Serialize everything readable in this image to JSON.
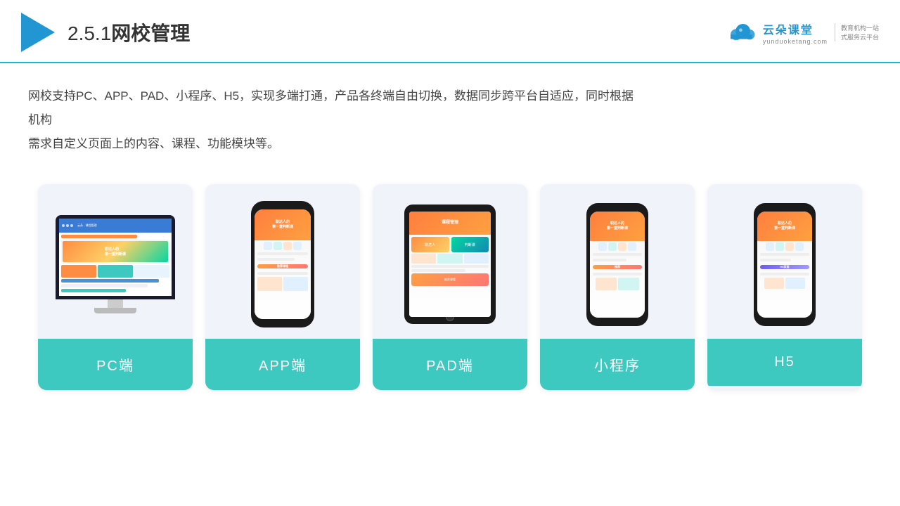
{
  "header": {
    "section_number": "2.5.1",
    "title": "网校管理",
    "logo_cn": "云朵课堂",
    "logo_en": "yunduoketang.com",
    "logo_slogan": "教育机构一站\n式服务云平台"
  },
  "description": {
    "text1": "网校支持PC、APP、PAD、小程序、H5，实现多端打通，产品各终端自由切换，数据同步跨平台自适应，同时根据机构",
    "text2": "需求自定义页面上的内容、课程、功能模块等。"
  },
  "cards": [
    {
      "id": "pc",
      "label": "PC端"
    },
    {
      "id": "app",
      "label": "APP端"
    },
    {
      "id": "pad",
      "label": "PAD端"
    },
    {
      "id": "miniprogram",
      "label": "小程序"
    },
    {
      "id": "h5",
      "label": "H5"
    }
  ]
}
